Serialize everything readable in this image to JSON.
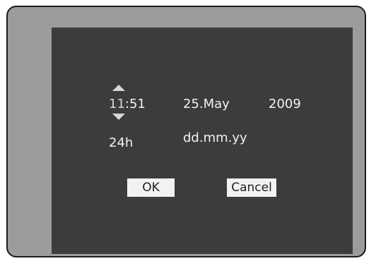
{
  "datetime": {
    "hour": "11",
    "separator": ":",
    "minute": "51",
    "date": "25.May",
    "year": "2009",
    "hour_format": "24h",
    "date_format": "dd.mm.yy"
  },
  "buttons": {
    "ok_label": "OK",
    "cancel_label": "Cancel"
  },
  "icons": {
    "up": "arrow-up-icon",
    "down": "arrow-down-icon"
  },
  "colors": {
    "bezel": "#9c9c9c",
    "screen": "#3c3c3c",
    "text": "#f2f2f2",
    "button_bg": "#f2f2f2"
  }
}
